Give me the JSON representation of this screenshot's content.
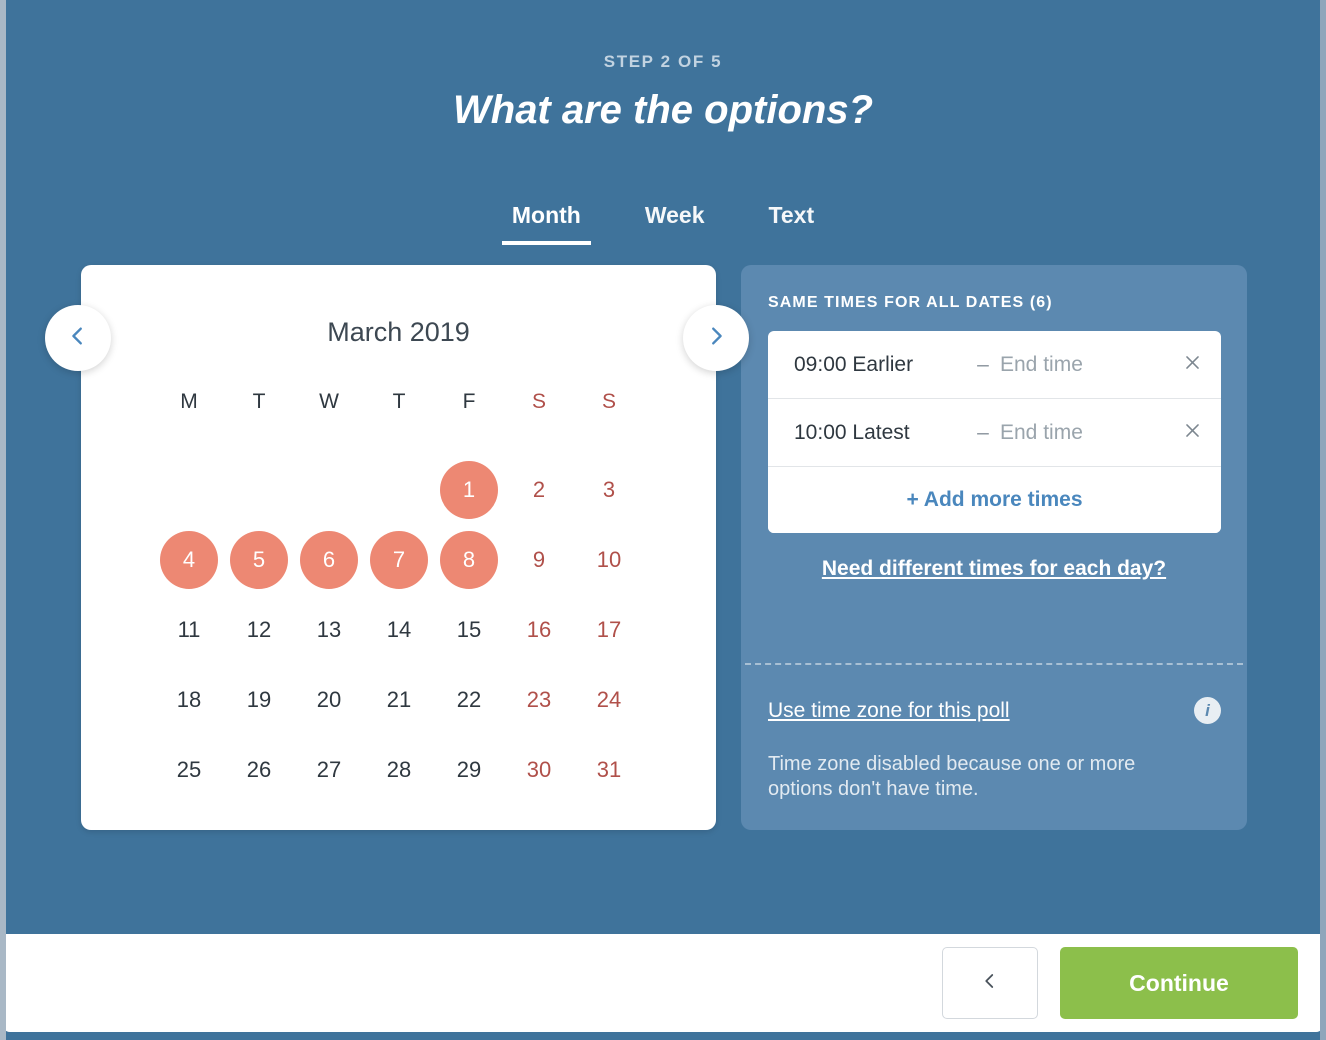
{
  "colors": {
    "background": "#3f739b",
    "panel": "#5c89b0",
    "selected_day": "#ed8873",
    "weekend_text": "#b0504a",
    "continue_button": "#8cbf4b",
    "link_blue": "#4a87bd"
  },
  "header": {
    "step_label": "STEP 2 OF 5",
    "title": "What are the options?"
  },
  "tabs": [
    {
      "label": "Month",
      "active": true
    },
    {
      "label": "Week",
      "active": false
    },
    {
      "label": "Text",
      "active": false
    }
  ],
  "calendar": {
    "month_title": "March 2019",
    "prev_icon": "chevron-left-icon",
    "next_icon": "chevron-right-icon",
    "weekday_headers": [
      {
        "label": "M",
        "weekend": false
      },
      {
        "label": "T",
        "weekend": false
      },
      {
        "label": "W",
        "weekend": false
      },
      {
        "label": "T",
        "weekend": false
      },
      {
        "label": "F",
        "weekend": false
      },
      {
        "label": "S",
        "weekend": true
      },
      {
        "label": "S",
        "weekend": true
      }
    ],
    "leading_blanks": 4,
    "days": [
      {
        "n": "1",
        "selected": true,
        "weekend": false
      },
      {
        "n": "2",
        "selected": false,
        "weekend": true
      },
      {
        "n": "3",
        "selected": false,
        "weekend": true
      },
      {
        "n": "4",
        "selected": true,
        "weekend": false
      },
      {
        "n": "5",
        "selected": true,
        "weekend": false
      },
      {
        "n": "6",
        "selected": true,
        "weekend": false
      },
      {
        "n": "7",
        "selected": true,
        "weekend": false
      },
      {
        "n": "8",
        "selected": true,
        "weekend": false
      },
      {
        "n": "9",
        "selected": false,
        "weekend": true
      },
      {
        "n": "10",
        "selected": false,
        "weekend": true
      },
      {
        "n": "11",
        "selected": false,
        "weekend": false
      },
      {
        "n": "12",
        "selected": false,
        "weekend": false
      },
      {
        "n": "13",
        "selected": false,
        "weekend": false
      },
      {
        "n": "14",
        "selected": false,
        "weekend": false
      },
      {
        "n": "15",
        "selected": false,
        "weekend": false
      },
      {
        "n": "16",
        "selected": false,
        "weekend": true
      },
      {
        "n": "17",
        "selected": false,
        "weekend": true
      },
      {
        "n": "18",
        "selected": false,
        "weekend": false
      },
      {
        "n": "19",
        "selected": false,
        "weekend": false
      },
      {
        "n": "20",
        "selected": false,
        "weekend": false
      },
      {
        "n": "21",
        "selected": false,
        "weekend": false
      },
      {
        "n": "22",
        "selected": false,
        "weekend": false
      },
      {
        "n": "23",
        "selected": false,
        "weekend": true
      },
      {
        "n": "24",
        "selected": false,
        "weekend": true
      },
      {
        "n": "25",
        "selected": false,
        "weekend": false
      },
      {
        "n": "26",
        "selected": false,
        "weekend": false
      },
      {
        "n": "27",
        "selected": false,
        "weekend": false
      },
      {
        "n": "28",
        "selected": false,
        "weekend": false
      },
      {
        "n": "29",
        "selected": false,
        "weekend": false
      },
      {
        "n": "30",
        "selected": false,
        "weekend": true
      },
      {
        "n": "31",
        "selected": false,
        "weekend": true
      }
    ]
  },
  "times_panel": {
    "heading": "SAME TIMES FOR ALL DATES (6)",
    "rows": [
      {
        "start": "09:00 Earlier",
        "dash": "–",
        "end_placeholder": "End time",
        "remove_icon": "close-icon"
      },
      {
        "start": "10:00 Latest",
        "dash": "–",
        "end_placeholder": "End time",
        "remove_icon": "close-icon"
      }
    ],
    "add_more_label": "+ Add more times",
    "different_times_link": "Need different times for each day?",
    "timezone_link": "Use time zone for this poll",
    "timezone_info_icon": "info-icon",
    "timezone_note": "Time zone disabled because one or more options don't have time."
  },
  "footer": {
    "back_icon": "chevron-left-icon",
    "continue_label": "Continue"
  }
}
